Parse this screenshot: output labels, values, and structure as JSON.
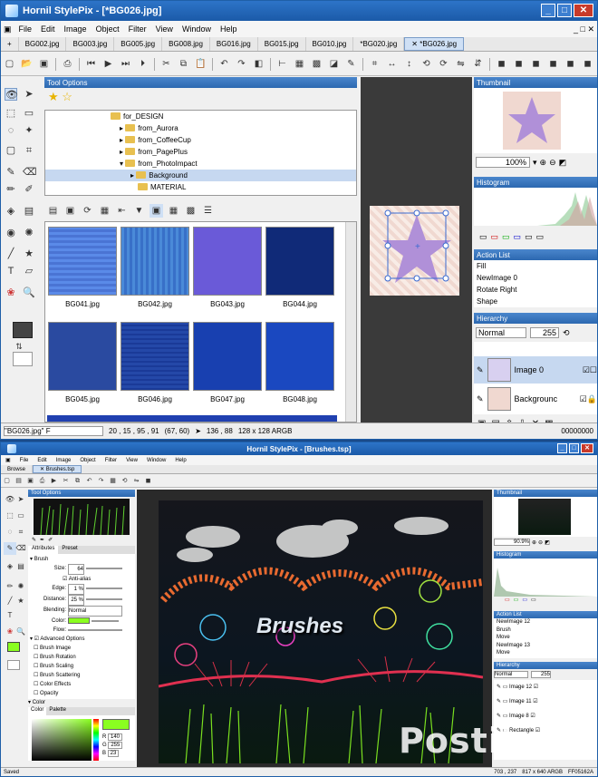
{
  "w1": {
    "title": "Hornil StylePix - [*BG026.jpg]",
    "menus": [
      "File",
      "Edit",
      "Image",
      "Object",
      "Filter",
      "View",
      "Window",
      "Help"
    ],
    "tabs": [
      "BG002.jpg",
      "BG003.jpg",
      "BG005.jpg",
      "BG008.jpg",
      "BG016.jpg",
      "BG015.jpg",
      "BG010.jpg",
      "*BG020.jpg",
      "✕ *BG026.jpg"
    ],
    "tool_options": "Tool Options",
    "tree": [
      "for_DESIGN",
      "from_Aurora",
      "from_CoffeeCup",
      "from_PagePlus",
      "from_PhotoImpact",
      "Background",
      "MATERIAL"
    ],
    "thumbs": [
      "BG041.jpg",
      "BG042.jpg",
      "BG043.jpg",
      "BG044.jpg",
      "BG045.jpg",
      "BG046.jpg",
      "BG047.jpg",
      "BG048.jpg"
    ],
    "thumbnail_title": "Thumbnail",
    "zoom": "100%",
    "histogram_title": "Histogram",
    "actionlist_title": "Action List",
    "actions": [
      "Fill",
      "NewImage 0",
      "Rotate Right",
      "Shape"
    ],
    "hierarchy_title": "Hierarchy",
    "blend": "Normal",
    "opacity": "255",
    "layers": [
      "Image 0",
      "Backgrounc"
    ],
    "status": {
      "file": "\"BG026.jpg\" F",
      "coords": "20 , 15 , 95 , 91",
      "pos": "(67, 60)",
      "cursor": "136 , 88",
      "size": "128 x 128 ARGB",
      "val": "00000000"
    }
  },
  "w2": {
    "title": "Hornil StylePix - [Brushes.tsp]",
    "menus": [
      "File",
      "Edit",
      "Image",
      "Object",
      "Filter",
      "View",
      "Window",
      "Help"
    ],
    "tabs": [
      "Browse",
      "✕ Brushes.tsp"
    ],
    "tool_options": "Tool Options",
    "subtabs": [
      "Attributes",
      "Preset"
    ],
    "brush": {
      "section": "Brush",
      "size_label": "Size:",
      "size": "64",
      "antialias": "Anti-alias",
      "edge_label": "Edge:",
      "edge": "1 %",
      "distance_label": "Distance:",
      "distance": "25 %",
      "blending_label": "Blending:",
      "blending": "Normal",
      "color_label": "Color:",
      "flow_label": "Flow:"
    },
    "advanced": "Advanced Options",
    "adv_items": [
      "Brush Image",
      "Brush Rotation",
      "Brush Scaling",
      "Brush Scattering",
      "Color Effects",
      "Opacity"
    ],
    "color_section": "Color",
    "color_tabs": [
      "Color",
      "Palette"
    ],
    "rgb": {
      "r": "140",
      "g": "255",
      "b": "23"
    },
    "canvas_text": "Brushes",
    "thumbnail_title": "Thumbnail",
    "zoom": "90.9%",
    "histogram_title": "Histogram",
    "actionlist_title": "Action List",
    "actions": [
      "NewImage 12",
      "Brush",
      "Move",
      "NewImage 13",
      "Move"
    ],
    "hierarchy_title": "Hierarchy",
    "blend": "Normal",
    "opacity": "255",
    "layers": [
      "Image 12",
      "Image 11",
      "Image 8",
      "Rectangle"
    ],
    "status": {
      "text": "Saved",
      "cursor": "703 , 237",
      "size": "817 x 640 ARGB",
      "val": "FF05162A"
    }
  },
  "watermark": "Postila.ru"
}
